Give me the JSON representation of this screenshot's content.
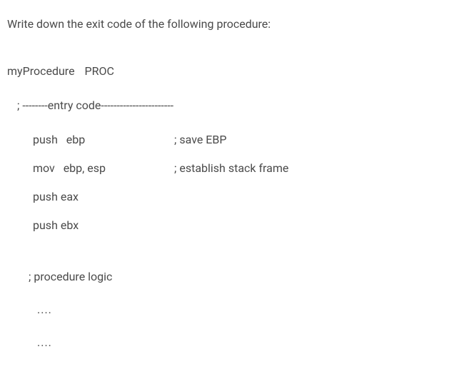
{
  "question": "Write down the exit code of the following procedure:",
  "proc": {
    "name": "myProcedure",
    "keyword": "PROC"
  },
  "entry_comment": "; --------entry code-----------------------",
  "lines": [
    {
      "instr": "push   ebp",
      "comment": "; save EBP"
    },
    {
      "instr": "mov   ebp, esp",
      "comment": "; establish stack frame"
    },
    {
      "instr": "push eax",
      "comment": ""
    },
    {
      "instr": "push ebx",
      "comment": ""
    }
  ],
  "logic_label": "; procedure logic",
  "ellipsis1": "....",
  "ellipsis2": "...."
}
